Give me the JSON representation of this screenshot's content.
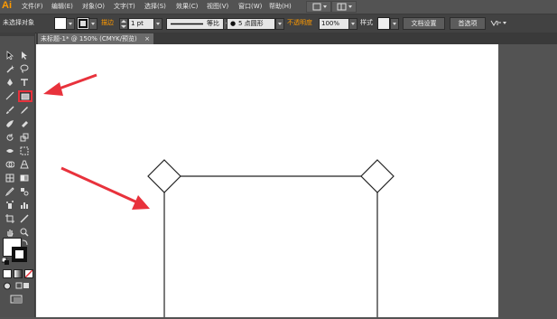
{
  "app": {
    "logo": "Ai"
  },
  "menubar": {
    "items": [
      "文件(F)",
      "编辑(E)",
      "对象(O)",
      "文字(T)",
      "选择(S)",
      "效果(C)",
      "视图(V)",
      "窗口(W)",
      "帮助(H)"
    ]
  },
  "controlbar": {
    "selection_status": "未选择对象",
    "stroke_label": "描边",
    "stroke_weight": "1 pt",
    "profile": "等比",
    "brush": "5 点圆形",
    "opacity_label": "不透明度",
    "opacity_value": "100%",
    "style_label": "样式",
    "doc_setup_button": "文档设置",
    "preferences_button": "首选项"
  },
  "document": {
    "tab_title": "未标题-1* @ 150% (CMYK/预览)",
    "close_glyph": "×"
  },
  "colors": {
    "app_bg": "#535353",
    "control_bg": "#424242",
    "accent_logo": "#ff9a00",
    "annotation_red": "#e8323c",
    "canvas": "#ffffff"
  }
}
